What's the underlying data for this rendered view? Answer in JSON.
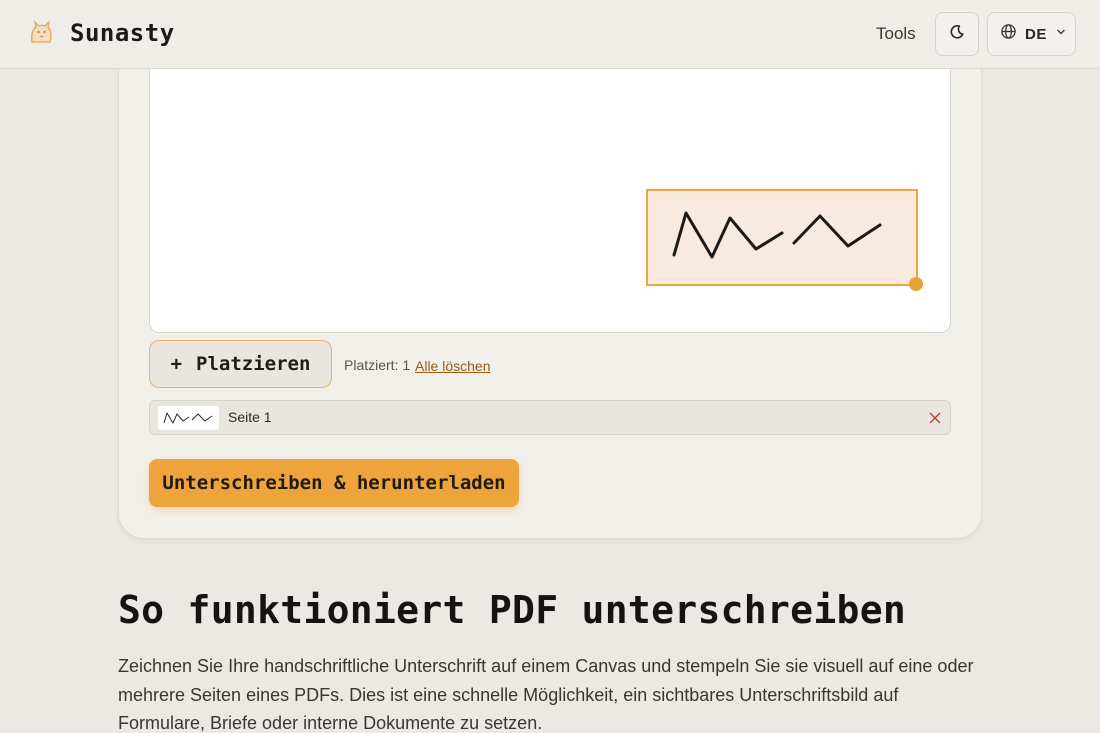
{
  "header": {
    "brand": "Sunasty",
    "nav_tools": "Tools",
    "lang_label": "DE",
    "icons": {
      "logo": "cat-logo-icon",
      "theme": "moon-icon",
      "lang": "globe-icon",
      "dropdown": "chevron-down-icon"
    }
  },
  "signer": {
    "place_button_plus": "+",
    "place_button_label": "Platzieren",
    "placed_text": "Platziert: 1",
    "clear_all_link": "Alle löschen",
    "pages": [
      {
        "label": "Seite 1"
      }
    ],
    "submit_label": "Unterschreiben & herunterladen"
  },
  "content": {
    "title": "So funktioniert PDF unterschreiben",
    "paragraph": "Zeichnen Sie Ihre handschriftliche Unterschrift auf einem Canvas und stempeln Sie sie visuell auf eine oder mehrere Seiten eines PDFs. Dies ist eine schnelle Möglichkeit, ein sichtbares Unterschriftsbild auf Formulare, Briefe oder interne Dokumente zu setzen."
  },
  "colors": {
    "accent": "#eea43c",
    "signature_box_border": "#eba63f",
    "link": "#9a5a10",
    "remove": "#c0392b"
  }
}
